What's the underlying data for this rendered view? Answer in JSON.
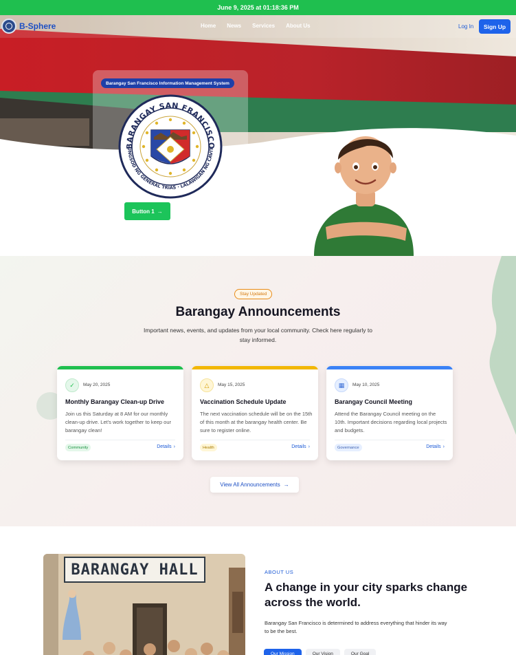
{
  "topbar": {
    "datetime": "June 9, 2025 at 01:18:36 PM"
  },
  "nav": {
    "brand": "B-Sphere",
    "links": [
      "Home",
      "News",
      "Services",
      "About Us"
    ],
    "login": "Log In",
    "signup": "Sign Up"
  },
  "hero": {
    "badge": "Barangay San Francisco Information Management System",
    "button_label": "Button 1",
    "seal_text": {
      "top": "BARANGAY SAN FRANCISCO",
      "bottom": "LUNGSOD NG GENERAL TRIAS · LALAWIGAN NG CAVITE"
    }
  },
  "announcements": {
    "badge": "Stay Updated",
    "title": "Barangay Announcements",
    "description": "Important news, events, and updates from your local community. Check here regularly to stay informed.",
    "cards": [
      {
        "date": "May 20, 2025",
        "title": "Monthly Barangay Clean-up Drive",
        "text": "Join us this Saturday at 8 AM for our monthly clean-up drive. Let's work together to keep our barangay clean!",
        "tag": "Community",
        "link": "Details",
        "icon": "check-circle-icon",
        "color": "#1fbf4f"
      },
      {
        "date": "May 15, 2025",
        "title": "Vaccination Schedule Update",
        "text": "The next vaccination schedule will be on the 15th of this month at the barangay health center. Be sure to register online.",
        "tag": "Health",
        "link": "Details",
        "icon": "warning-icon",
        "color": "#f2b705"
      },
      {
        "date": "May 10, 2025",
        "title": "Barangay Council Meeting",
        "text": "Attend the Barangay Council meeting on the 10th. Important decisions regarding local projects and budgets.",
        "tag": "Governance",
        "link": "Details",
        "icon": "calendar-icon",
        "color": "#3b82f6"
      }
    ],
    "view_all": "View All Announcements"
  },
  "about": {
    "sign": "BARANGAY HALL",
    "label": "ABOUT US",
    "title": "A change in your city sparks change across the world.",
    "description": "Barangay San Francisco is determined to address everything that hinder its way to be the best.",
    "tabs": [
      "Our Mission",
      "Our Vision",
      "Our Goal"
    ]
  }
}
